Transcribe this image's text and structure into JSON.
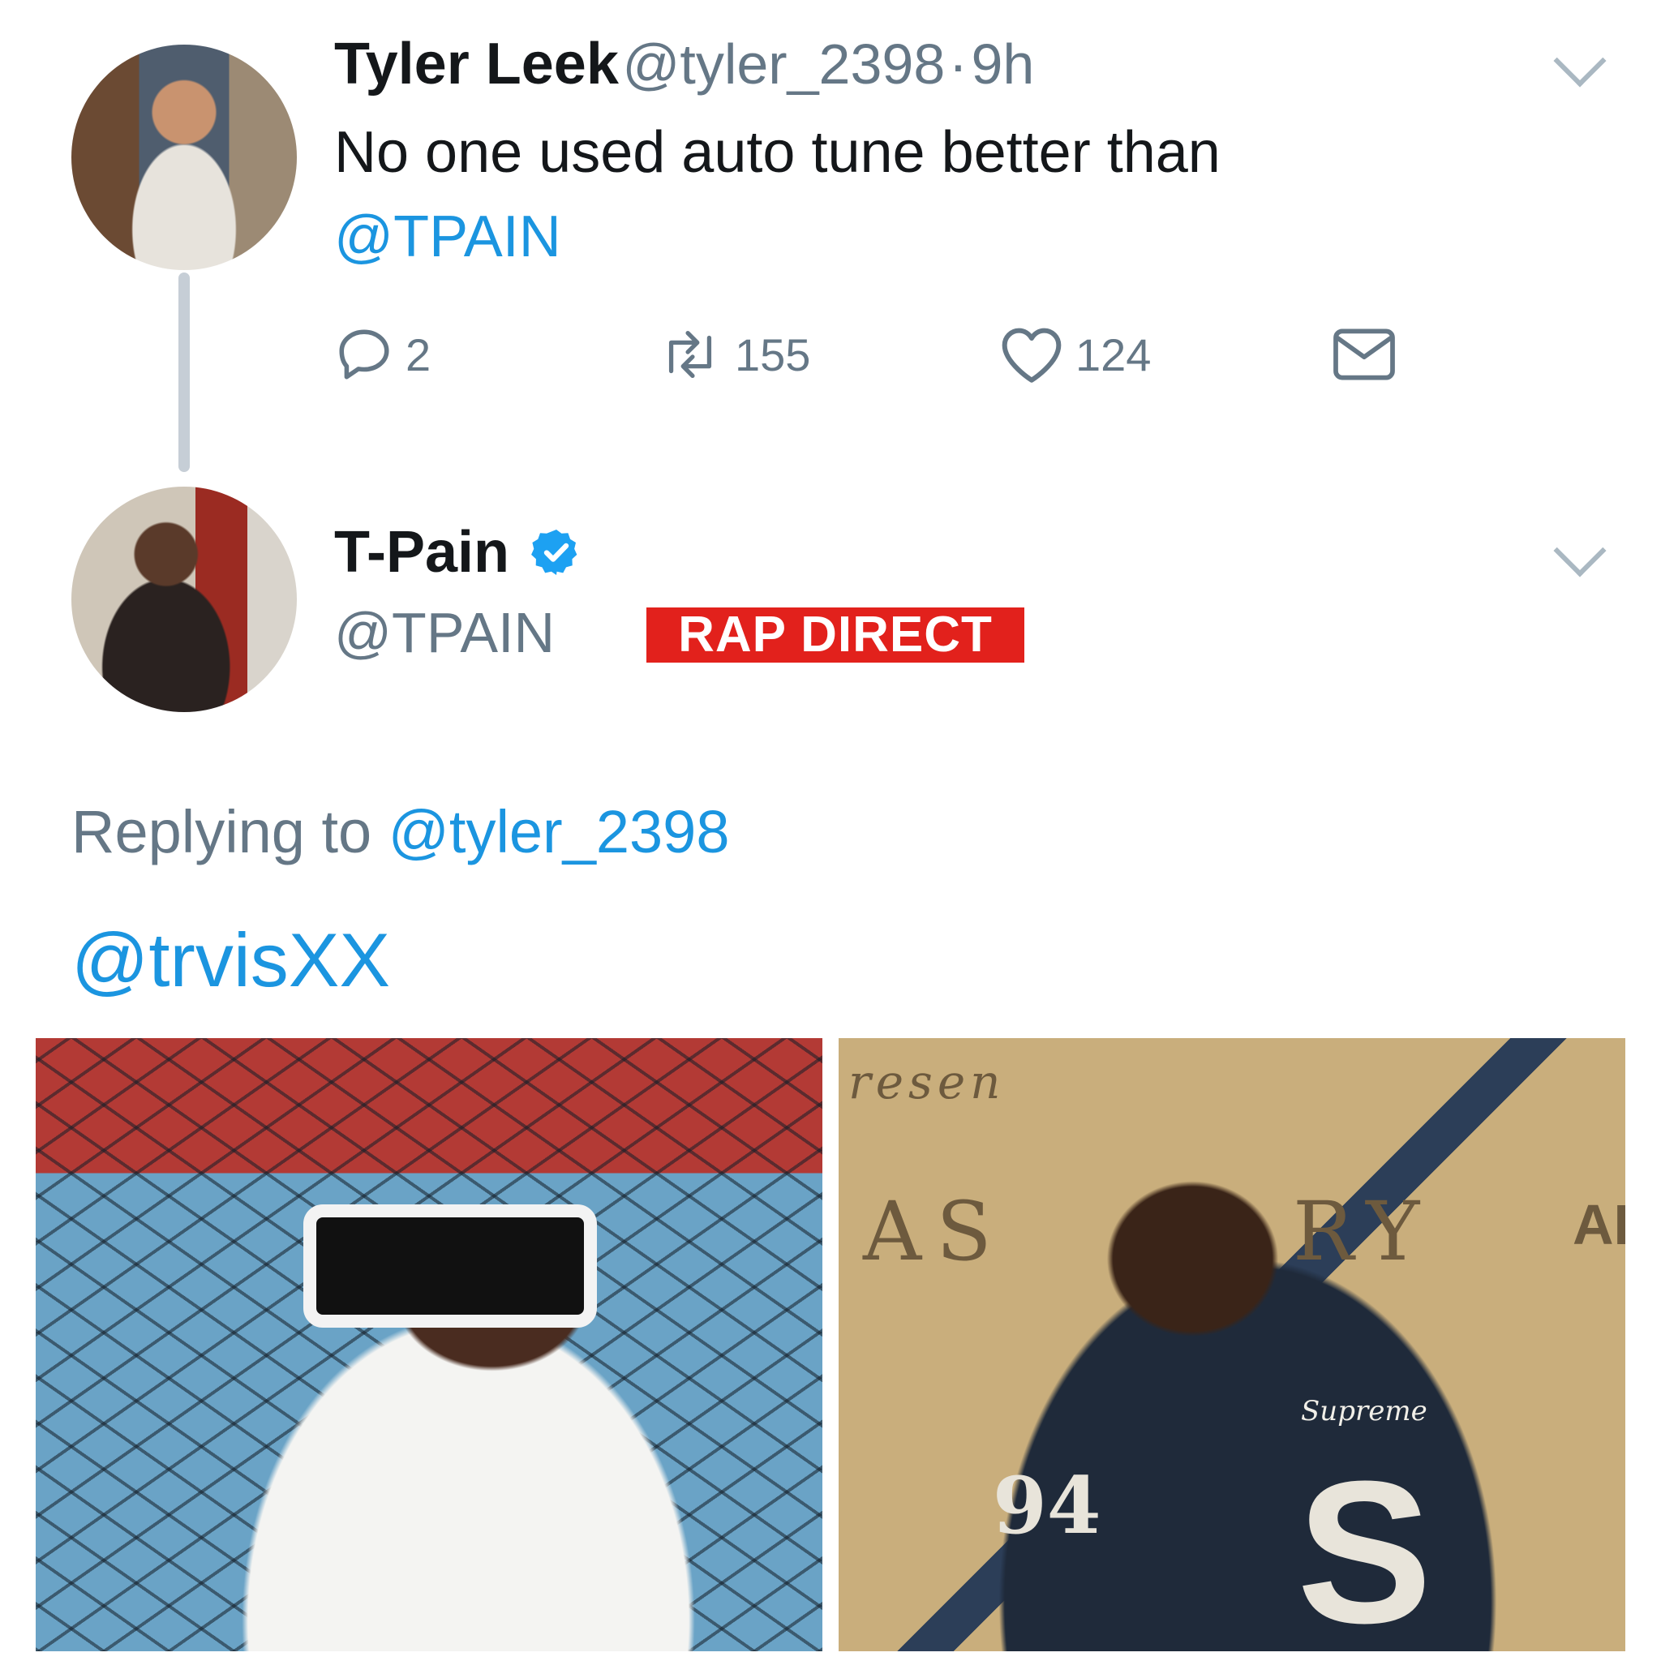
{
  "tweet1": {
    "name": "Tyler Leek",
    "handle": "@tyler_2398",
    "separator": "·",
    "time": "9h",
    "text": "No one used auto tune better than",
    "mention": "@TPAIN",
    "actions": {
      "replies": "2",
      "retweets": "155",
      "likes": "124"
    }
  },
  "tweet2": {
    "name": "T-Pain",
    "handle": "@TPAIN",
    "verified": true,
    "replying_label": "Replying to",
    "replying_handle": "@tyler_2398",
    "text": "@trvisXX"
  },
  "watermark": {
    "label": "RAP DIRECT",
    "color": "#e2211c"
  },
  "photo_right_text": {
    "top": "resen",
    "left": "AS",
    "right": "RY",
    "corner": "AE",
    "jacket_brand": "Supreme",
    "jacket_number": "94",
    "jacket_letter": "S"
  },
  "icons": {
    "reply": "reply-icon",
    "retweet": "retweet-icon",
    "like": "heart-icon",
    "dm": "envelope-icon",
    "caret": "chevron-down-icon",
    "verified": "verified-badge-icon"
  },
  "colors": {
    "link": "#1b95e0",
    "secondary": "#657786",
    "thread_line": "#c6ced6",
    "verified": "#1da1f2"
  }
}
